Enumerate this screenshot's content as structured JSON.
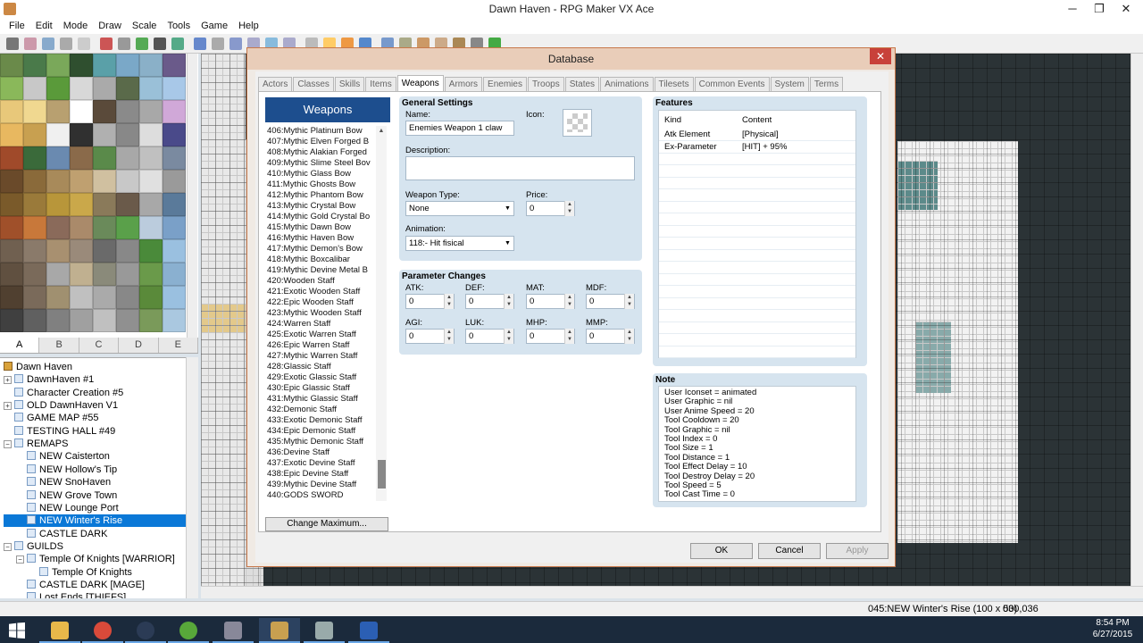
{
  "app": {
    "title": "Dawn Haven - RPG Maker VX Ace",
    "menu": [
      "File",
      "Edit",
      "Mode",
      "Draw",
      "Scale",
      "Tools",
      "Game",
      "Help"
    ]
  },
  "tileset_tabs": [
    "A",
    "B",
    "C",
    "D",
    "E"
  ],
  "map_tree": [
    {
      "label": "Dawn Haven",
      "level": 0,
      "expand": "",
      "icon": "project-icon"
    },
    {
      "label": "DawnHaven #1",
      "level": 0,
      "expand": "+",
      "icon": "map-icon"
    },
    {
      "label": "Character Creation #5",
      "level": 0,
      "expand": "",
      "icon": "map-icon"
    },
    {
      "label": "OLD DawnHaven V1",
      "level": 0,
      "expand": "+",
      "icon": "map-icon"
    },
    {
      "label": "GAME MAP #55",
      "level": 0,
      "expand": "",
      "icon": "map-icon"
    },
    {
      "label": "TESTING HALL #49",
      "level": 0,
      "expand": "",
      "icon": "map-icon"
    },
    {
      "label": "REMAPS",
      "level": 0,
      "expand": "−",
      "icon": "map-icon"
    },
    {
      "label": "NEW Caisterton",
      "level": 1,
      "expand": "",
      "icon": "map-icon"
    },
    {
      "label": "NEW Hollow's Tip",
      "level": 1,
      "expand": "",
      "icon": "map-icon"
    },
    {
      "label": "NEW SnoHaven",
      "level": 1,
      "expand": "",
      "icon": "map-icon"
    },
    {
      "label": "NEW Grove Town",
      "level": 1,
      "expand": "",
      "icon": "map-icon"
    },
    {
      "label": "NEW Lounge Port",
      "level": 1,
      "expand": "",
      "icon": "map-icon"
    },
    {
      "label": "NEW Winter's Rise",
      "level": 1,
      "expand": "",
      "icon": "map-icon",
      "selected": true
    },
    {
      "label": "CASTLE DARK",
      "level": 1,
      "expand": "",
      "icon": "map-icon"
    },
    {
      "label": "GUILDS",
      "level": 0,
      "expand": "−",
      "icon": "map-icon"
    },
    {
      "label": "Temple Of Knights [WARRIOR]",
      "level": 1,
      "expand": "−",
      "icon": "map-icon"
    },
    {
      "label": "Temple Of Knights",
      "level": 2,
      "expand": "",
      "icon": "map-icon"
    },
    {
      "label": "CASTLE DARK [MAGE]",
      "level": 1,
      "expand": "",
      "icon": "map-icon"
    },
    {
      "label": "Lost Ends [THIEFS]",
      "level": 1,
      "expand": "",
      "icon": "map-icon"
    }
  ],
  "status": {
    "map": "045:NEW Winter's Rise (100 x 50)",
    "coords": "030,036"
  },
  "clock": {
    "time": "8:54 PM",
    "date": "6/27/2015"
  },
  "dialog": {
    "title": "Database",
    "close": "✕",
    "tabs": [
      "Actors",
      "Classes",
      "Skills",
      "Items",
      "Weapons",
      "Armors",
      "Enemies",
      "Troops",
      "States",
      "Animations",
      "Tilesets",
      "Common Events",
      "System",
      "Terms"
    ],
    "selected_tab": "Weapons",
    "list_header": "Weapons",
    "weapons": [
      "406:Mythic Platinum Bow",
      "407:Mythic Elven Forged B",
      "408:Mythic Alakian Forged",
      "409:Mythic Slime Steel Bov",
      "410:Mythic Glass Bow",
      "411:Mythic Ghosts Bow",
      "412:Mythic Phantom Bow",
      "413:Mythic Crystal Bow",
      "414:Mythic Gold Crystal Bo",
      "415:Mythic Dawn Bow",
      "416:Mythic Haven Bow",
      "417:Mythic Demon's Bow",
      "418:Mythic Boxcalibar",
      "419:Mythic Devine Metal B",
      "420:Wooden Staff",
      "421:Exotic Wooden Staff",
      "422:Epic Wooden Staff",
      "423:Mythic Wooden Staff",
      "424:Warren Staff",
      "425:Exotic Warren Staff",
      "426:Epic Warren Staff",
      "427:Mythic Warren Staff",
      "428:Glassic Staff",
      "429:Exotic Glassic Staff",
      "430:Epic Glassic Staff",
      "431:Mythic Glassic Staff",
      "432:Demonic Staff",
      "433:Exotic Demonic Staff",
      "434:Epic Demonic Staff",
      "435:Mythic Demonic Staff",
      "436:Devine Staff",
      "437:Exotic Devine Staff",
      "438:Epic Devine Staff",
      "439:Mythic Devine Staff",
      "440:GODS SWORD"
    ],
    "change_max": "Change Maximum...",
    "general": {
      "title": "General Settings",
      "name_label": "Name:",
      "name_value": "Enemies Weapon 1 claw",
      "icon_label": "Icon:",
      "desc_label": "Description:",
      "desc_value": "",
      "type_label": "Weapon Type:",
      "type_value": "None",
      "price_label": "Price:",
      "price_value": "0",
      "anim_label": "Animation:",
      "anim_value": "118:- Hit fisical"
    },
    "params": {
      "title": "Parameter Changes",
      "items": [
        {
          "label": "ATK:",
          "value": "0"
        },
        {
          "label": "DEF:",
          "value": "0"
        },
        {
          "label": "MAT:",
          "value": "0"
        },
        {
          "label": "MDF:",
          "value": "0"
        },
        {
          "label": "AGI:",
          "value": "0"
        },
        {
          "label": "LUK:",
          "value": "0"
        },
        {
          "label": "MHP:",
          "value": "0"
        },
        {
          "label": "MMP:",
          "value": "0"
        }
      ]
    },
    "features": {
      "title": "Features",
      "col_kind": "Kind",
      "col_content": "Content",
      "rows": [
        {
          "kind": "Atk Element",
          "content": "[Physical]"
        },
        {
          "kind": "Ex-Parameter",
          "content": "[HIT] + 95%"
        }
      ]
    },
    "note": {
      "title": "Note",
      "lines": [
        "User Iconset = animated",
        "User Graphic = nil",
        "User Anime Speed = 20",
        "Tool Cooldown = 20",
        "Tool Graphic = nil",
        "Tool Index = 0",
        "Tool Size = 1",
        "Tool Distance = 1",
        "Tool Effect Delay = 10",
        "Tool Destroy Delay = 20",
        "Tool Speed = 5",
        "Tool Cast Time = 0"
      ]
    },
    "buttons": {
      "ok": "OK",
      "cancel": "Cancel",
      "apply": "Apply"
    }
  },
  "colors": {
    "accent": "#1d4e8e",
    "selection": "#0a78d7",
    "dialog_frame": "#c8784a"
  }
}
